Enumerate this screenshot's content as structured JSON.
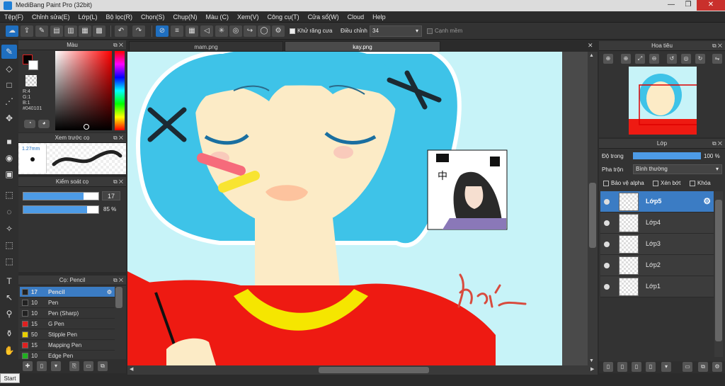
{
  "window": {
    "title": "MediBang Paint Pro (32bit)",
    "minimize": "—",
    "maximize": "❐",
    "close": "✕"
  },
  "menu": [
    "Tệp(F)",
    "Chỉnh sửa(E)",
    "Lớp(L)",
    "Bộ lọc(R)",
    "Chọn(S)",
    "Chụp(N)",
    "Màu (C)",
    "Xem(V)",
    "Công cụ(T)",
    "Cửa sổ(W)",
    "Cloud",
    "Help"
  ],
  "toolbar": {
    "antialias_label": "Khử răng cưa",
    "adjust_label": "Điều chỉnh",
    "adjust_value": "34",
    "edge_label": "Cạnh mềm"
  },
  "color_panel": {
    "title": "Màu",
    "r": "R:4",
    "g": "G:1",
    "b": "B:1",
    "hex": "#040101",
    "fg": "#040101",
    "bg": "#ffffff"
  },
  "brush_preview": {
    "title": "Xem trước cọ",
    "size": "1.27mm"
  },
  "brush_control": {
    "title": "Kiểm soát cọ",
    "size": "17",
    "opacity": "85 %",
    "size_level": 0.8,
    "opacity_level": 0.85
  },
  "brush_list": {
    "title": "Cọ: Pencil",
    "items": [
      {
        "size": "17",
        "name": "Pencil",
        "color": "#222222"
      },
      {
        "size": "10",
        "name": "Pen",
        "color": "#222222"
      },
      {
        "size": "10",
        "name": "Pen (Sharp)",
        "color": "#222222"
      },
      {
        "size": "15",
        "name": "G Pen",
        "color": "#e02020"
      },
      {
        "size": "50",
        "name": "Stipple Pen",
        "color": "#e8d000"
      },
      {
        "size": "15",
        "name": "Mapping Pen",
        "color": "#e02020"
      },
      {
        "size": "10",
        "name": "Edge Pen",
        "color": "#20b020"
      }
    ]
  },
  "tabs": [
    "mam.png",
    "kay.png"
  ],
  "canvas": {
    "signature": "hai",
    "sticker_char": "中"
  },
  "navigator": {
    "title": "Hoa tiêu"
  },
  "layers": {
    "title": "Lớp",
    "opacity_label": "Độ trong",
    "opacity_value": "100 %",
    "opacity_level": 1.0,
    "blend_label": "Pha trộn",
    "blend_value": "Bình thường",
    "protect_alpha": "Bảo vệ alpha",
    "clipping": "Xén bớt",
    "lock": "Khóa",
    "items": [
      {
        "name": "Lớp5",
        "selected": true
      },
      {
        "name": "Lớp4",
        "selected": false
      },
      {
        "name": "Lớp3",
        "selected": false
      },
      {
        "name": "Lớp2",
        "selected": false
      },
      {
        "name": "Lớp1",
        "selected": false
      }
    ]
  },
  "taskbar": {
    "start": "Start"
  },
  "colors": {
    "accent": "#3b7cc4",
    "canvas_bg": "#c7f3f8",
    "hair": "#3ec3e8",
    "shirt": "#ee1a12",
    "collar": "#f5e600"
  }
}
